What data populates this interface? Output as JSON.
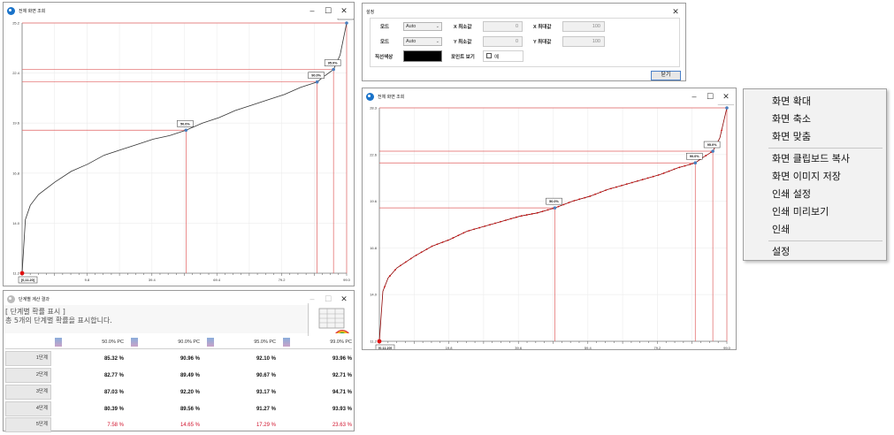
{
  "chart_window_1": {
    "title": "전체 화면 조회",
    "y_ticks": [
      "25.2",
      "22.4",
      "19.6",
      "16.8",
      "14.0",
      "11.2"
    ],
    "x_ticks": [
      "9.8",
      "39.4",
      "69.4",
      "79.2",
      "99.0"
    ],
    "start_label": "[0,11.20]",
    "markers": [
      {
        "label": "50.0%"
      },
      {
        "label": "90.0%"
      },
      {
        "label": "95.0%"
      },
      {
        "label": "99.0%"
      }
    ],
    "chart_data": {
      "type": "line",
      "x": [
        0.0,
        1.0,
        2.5,
        5.0,
        10.0,
        15.0,
        20.0,
        25.0,
        30.0,
        35.0,
        40.0,
        45.0,
        50.0,
        55.0,
        60.0,
        65.0,
        70.0,
        75.0,
        80.0,
        85.0,
        90.0,
        92.0,
        95.0,
        97.0,
        99.0
      ],
      "y": [
        11.2,
        14.2,
        15.0,
        15.6,
        16.3,
        16.9,
        17.3,
        17.8,
        18.1,
        18.4,
        18.7,
        18.9,
        19.2,
        19.6,
        19.9,
        20.3,
        20.6,
        20.9,
        21.2,
        21.6,
        21.9,
        22.2,
        22.6,
        23.4,
        25.2
      ],
      "xlim": [
        0,
        99
      ],
      "ylim": [
        11.2,
        25.2
      ],
      "color": "#333333",
      "marker_color": "#4a7fbf",
      "guide_color": "#e06060"
    }
  },
  "chart_window_2": {
    "title": "전체 화면 조회",
    "y_ticks": [
      "28.3",
      "22.6",
      "19.6",
      "16.8",
      "14.0",
      "11.2"
    ],
    "x_ticks": [
      "19.8",
      "39.6",
      "59.4",
      "79.2",
      "99.0"
    ],
    "start_label": "[0,11.20]",
    "markers": [
      {
        "label": "50.0%"
      },
      {
        "label": "90.0%"
      },
      {
        "label": "95.0%"
      },
      {
        "label": "99.0%"
      }
    ],
    "chart_data": {
      "type": "line",
      "x": [
        0.0,
        1.0,
        2.5,
        5.0,
        10.0,
        15.0,
        20.0,
        25.0,
        30.0,
        35.0,
        40.0,
        45.0,
        50.0,
        55.0,
        60.0,
        65.0,
        70.0,
        75.0,
        80.0,
        85.0,
        90.0,
        92.0,
        95.0,
        97.0,
        99.0
      ],
      "y": [
        11.2,
        14.2,
        15.0,
        15.6,
        16.3,
        16.9,
        17.3,
        17.8,
        18.1,
        18.4,
        18.7,
        18.9,
        19.2,
        19.6,
        19.9,
        20.3,
        20.6,
        20.9,
        21.2,
        21.6,
        21.9,
        22.2,
        22.6,
        23.4,
        25.2
      ],
      "xlim": [
        0,
        99
      ],
      "ylim": [
        11.2,
        25.2
      ],
      "color": "#8b0000",
      "point_color": "#cc1010",
      "marker_color": "#4a7fbf",
      "guide_color": "#e06060"
    }
  },
  "settings": {
    "title": "설정",
    "mode_label": "모드",
    "mode1_value": "Auto",
    "mode2_value": "Auto",
    "x_min_label": "X 최소값",
    "x_min_value": "0",
    "x_max_label": "X 최대값",
    "x_max_value": "100",
    "y_min_label": "Y 최소값",
    "y_min_value": "0",
    "y_max_label": "Y 최대값",
    "y_max_value": "100",
    "line_color_label": "직선색상",
    "line_color": "#000000",
    "point_view_label": "포인트 보기",
    "point_view_check": "예",
    "ok_label": "닫기"
  },
  "context_menu": {
    "items": [
      "화면 확대",
      "화면 축소",
      "화면 맞춤",
      "화면 클립보드 복사",
      "화면 이미지 저장",
      "인쇄 설정",
      "인쇄 미리보기",
      "인쇄",
      "설정"
    ]
  },
  "results": {
    "title": "단계별 계산 결과",
    "heading1": "[ 단계별 확률 표시 ]",
    "heading2": "총 5개의 단계별 확률을 표시합니다.",
    "columns": [
      "50.0% PC",
      "90.0% PC",
      "95.0% PC",
      "99.0% PC"
    ],
    "rows": [
      {
        "label": "1단계",
        "values": [
          "85.32 %",
          "90.96 %",
          "92.10 %",
          "93.96 %"
        ]
      },
      {
        "label": "2단계",
        "values": [
          "82.77 %",
          "89.49 %",
          "90.67 %",
          "92.71 %"
        ]
      },
      {
        "label": "3단계",
        "values": [
          "87.03 %",
          "92.20 %",
          "93.17 %",
          "94.71 %"
        ]
      },
      {
        "label": "4단계",
        "values": [
          "80.39 %",
          "89.56 %",
          "91.27 %",
          "93.93 %"
        ]
      },
      {
        "label": "5단계",
        "values": [
          "7.58 %",
          "14.65 %",
          "17.29 %",
          "23.63 %"
        ]
      }
    ],
    "highlight_color": "#d0102a"
  }
}
